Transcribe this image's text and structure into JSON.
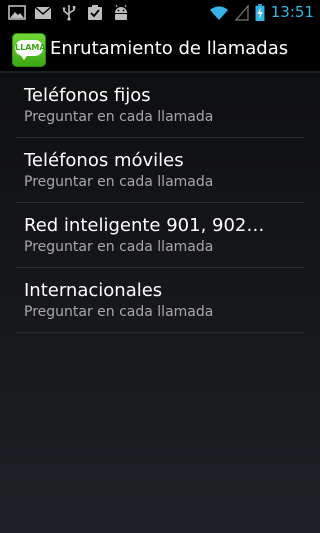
{
  "status_bar": {
    "time": "13:51",
    "icons": [
      "gallery-icon",
      "email-icon",
      "usb-icon",
      "task-check-icon",
      "android-icon",
      "wifi-icon",
      "signal-icon",
      "battery-charging-icon"
    ]
  },
  "action_bar": {
    "app_icon_text": "LLAMA",
    "title": "Enrutamiento de llamadas"
  },
  "list": {
    "items": [
      {
        "title": "Teléfonos fijos",
        "subtitle": "Preguntar en cada llamada"
      },
      {
        "title": "Teléfonos móviles",
        "subtitle": "Preguntar en cada llamada"
      },
      {
        "title": "Red inteligente 901, 902…",
        "subtitle": "Preguntar en cada llamada"
      },
      {
        "title": "Internacionales",
        "subtitle": "Preguntar en cada llamada"
      }
    ]
  },
  "colors": {
    "accent": "#33b5e5",
    "app_icon_green": "#4fc222"
  }
}
